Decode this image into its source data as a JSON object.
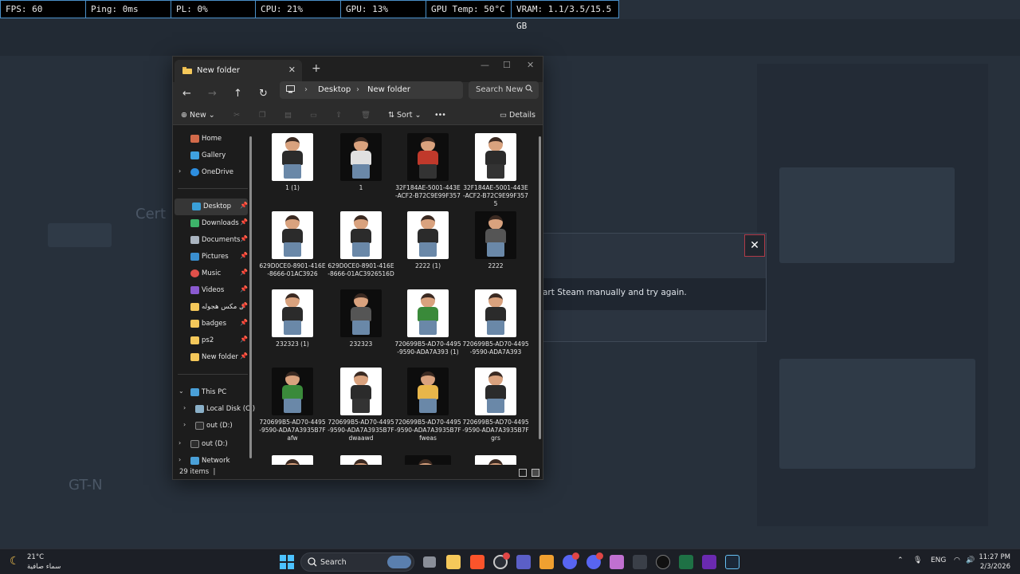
{
  "perf_overlay": {
    "items": [
      "FPS: 60",
      "Ping: 0ms",
      "PL: 0%",
      "CPU: 21%",
      "GPU: 13%",
      "GPU Temp: 50°C",
      "VRAM: 1.1/3.5/15.5 GB"
    ]
  },
  "dialog": {
    "message": "art Steam manually and try again.",
    "close_label": "✕"
  },
  "explorer": {
    "tab_title": "New folder",
    "breadcrumb": [
      "Desktop",
      "New folder"
    ],
    "search_placeholder": "Search New",
    "command_bar": {
      "new_label": "New",
      "sort_label": "Sort",
      "more_label": "•••",
      "details_label": "Details"
    },
    "nav": {
      "quick": [
        "Home",
        "Gallery",
        "OneDrive"
      ],
      "pinned": [
        "Desktop",
        "Downloads",
        "Documents",
        "Pictures",
        "Music",
        "Videos",
        "ل مكس هجوله",
        "badges",
        "ps2",
        "New folder"
      ],
      "this_pc": "This PC",
      "drives": [
        "Local Disk (C:)",
        "out (D:)",
        "out (D:)"
      ],
      "network": "Network"
    },
    "files": [
      "1 (1)",
      "1",
      "32F184AE-5001-443E-ACF2-B72C9E99F357",
      "32F184AE-5001-443E-ACF2-B72C9E99F3575",
      "629D0CE0-8901-416E-8666-01AC3926",
      "629D0CE0-8901-416E-8666-01AC3926516D",
      "2222 (1)",
      "2222",
      "232323 (1)",
      "232323",
      "720699B5-AD70-4495-9590-ADA7A393 (1)",
      "720699B5-AD70-4495-9590-ADA7A393",
      "720699B5-AD70-4495-9590-ADA7A3935B7Fafw",
      "720699B5-AD70-4495-9590-ADA7A3935B7Fdwaawd",
      "720699B5-AD70-4495-9590-ADA7A3935B7Ffweas",
      "720699B5-AD70-4495-9590-ADA7A3935B7Fgrs"
    ],
    "status_count": "29 items"
  },
  "taskbar": {
    "weather_temp": "21°C",
    "weather_desc": "سماء صافية",
    "search_label": "Search",
    "lang": "ENG",
    "time": "11:27 PM",
    "date": "2/3/2026",
    "accent_colors": {
      "brave": "#fb542b",
      "discord": "#5865f2",
      "teams": "#5b5fc7",
      "steam": "#66c0f4"
    }
  }
}
